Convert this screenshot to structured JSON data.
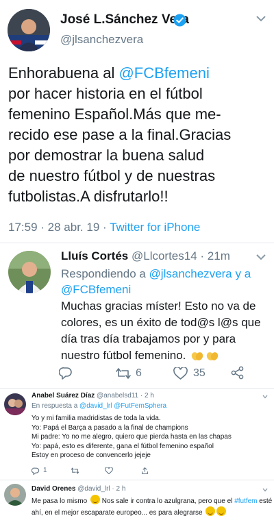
{
  "main_tweet": {
    "author_name": "José L.Sánchez Vera",
    "handle": "@jlsanchezvera",
    "text_lines": [
      {
        "before": "Enhorabuena al ",
        "mention": "@FCBfemeni",
        "after": ""
      },
      {
        "before": "por hacer historia en el fútbol",
        "mention": "",
        "after": ""
      },
      {
        "before": "femenino Español.Más que me-",
        "mention": "",
        "after": ""
      },
      {
        "before": "recido ese pase a la final.Gracias",
        "mention": "",
        "after": ""
      },
      {
        "before": "por demostrar la buena salud",
        "mention": "",
        "after": ""
      },
      {
        "before": "de nuestro fútbol y de nuestras",
        "mention": "",
        "after": ""
      },
      {
        "before": "futbolistas.A disfrutarlo!!",
        "mention": "",
        "after": ""
      }
    ],
    "meta": "17:59 · 28 abr. 19 · ",
    "source": "Twitter for iPhone",
    "colors": {
      "verified": "#1da1f2",
      "link": "#1da1f2"
    }
  },
  "reply_tweet": {
    "author_name": "Lluís Cortés",
    "handle_time": "@Llcortes14 · 21m",
    "replying_prefix": "Respondiendo a ",
    "replying_to_1": "@jlsanchezvera y a",
    "replying_to_2": "@FCBfemeni",
    "text_lines": [
      "Muchas gracias míster! Esto no va de",
      "colores, es un éxito de tod@s l@s que",
      "día tras día trabajamos por y para",
      "nuestro fútbol femenino."
    ],
    "reply_count": "",
    "retweet_count": "6",
    "like_count": "35"
  },
  "comment_1": {
    "author_name": "Anabel Suárez Díaz",
    "handle_time": "@anabelsd11 · 2 h",
    "reply_prefix": "En respuesta a ",
    "reply_to": "@david_lrl @FutFemSphera",
    "text_lines": [
      "Yo y mi familia madridistas de toda la vida.",
      "Yo: Papá el Barça a pasado a la final de champions",
      "Mi padre: Yo no me alegro, quiero que pierda hasta en las chapas",
      "Yo: papá, esto es diferente, gana el fútbol femenino español",
      "Estoy en proceso de convencerlo jejeje"
    ],
    "reply_count": "1",
    "retweet_count": "",
    "like_count": ""
  },
  "comment_2": {
    "author_name": "David Orenes",
    "handle_time": "@david_lrl · 2 h",
    "line1_before": "Me pasa lo mismo ",
    "line1_after": " Nos sale ir contra lo azulgrana, pero que el ",
    "hashtag": "#futfem",
    "line1_end": " esté",
    "line2": "ahí, en el mejor escaparate europeo... es para alegrarse "
  }
}
